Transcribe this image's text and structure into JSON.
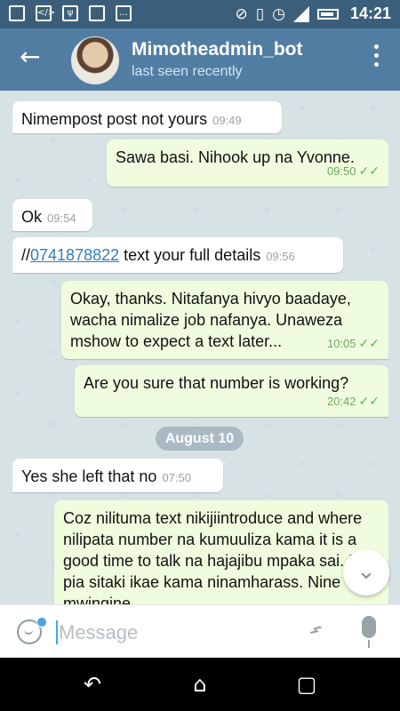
{
  "status_bar": {
    "time": "14:21",
    "left_icons": [
      "app-icon",
      "code-icon",
      "usb-icon",
      "storage-icon",
      "message-icon"
    ],
    "right_icons": [
      "mute-icon",
      "vibrate-icon",
      "alarm-icon",
      "signal-icon",
      "battery-icon"
    ]
  },
  "app_bar": {
    "back_icon": "←",
    "title": "Mimotheadmin_bot",
    "subtitle": "last seen recently",
    "menu_icon": "⋮"
  },
  "messages": [
    {
      "direction": "incoming",
      "text": "Nimempost post not yours",
      "time": "09:49"
    },
    {
      "direction": "outgoing",
      "text": "Sawa basi. Nihook up na Yvonne.",
      "time": "09:50",
      "read": true
    },
    {
      "direction": "incoming",
      "text": "Ok",
      "time": "09:54"
    },
    {
      "direction": "incoming",
      "prefix": "//",
      "phone": "0741878822",
      "text": " text your full details",
      "time": "09:56"
    },
    {
      "direction": "outgoing",
      "text": "Okay, thanks. Nitafanya hivyo baadaye, wacha nimalize job nafanya. Unaweza mshow to expect a text later...",
      "time": "10:05",
      "read": true
    },
    {
      "direction": "outgoing",
      "text": "Are you sure that number is working?",
      "time": "20:42",
      "read": true
    },
    {
      "direction": "date",
      "text": "August 10"
    },
    {
      "direction": "incoming",
      "text": "Yes she left that no",
      "time": "07:50"
    },
    {
      "direction": "outgoing",
      "text": "Coz nilituma text nikijiintroduce and where nilipata number na kumuuliza kama it is a good time to talk na hajajibu mpaka sai. Na pia sitaki ikae kama ninamharass. Nine mwingine",
      "time": ""
    }
  ],
  "composer": {
    "placeholder": "Message",
    "emoji_icon": "smile-icon",
    "attach_icon": "paperclip-icon",
    "mic_icon": "microphone-icon"
  },
  "scroll_down_icon": "⌄",
  "nav_bar": {
    "back": "↶",
    "home": "⌂",
    "recent": "▢"
  }
}
